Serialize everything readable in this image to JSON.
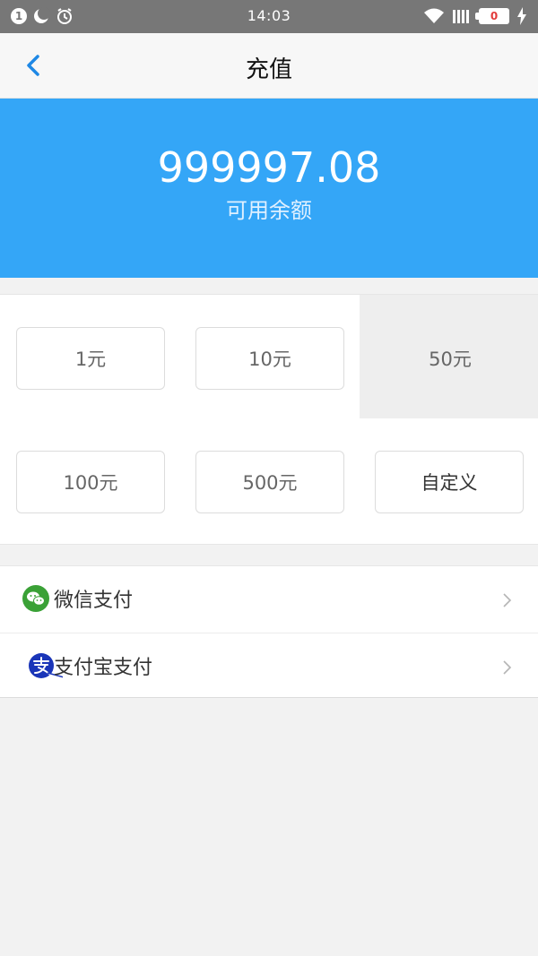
{
  "status_bar": {
    "time": "14:03",
    "notification_badge": "1",
    "battery_level": "0"
  },
  "nav": {
    "title": "充值"
  },
  "balance": {
    "amount": "999997.08",
    "label": "可用余额"
  },
  "amounts": [
    {
      "label": "1元",
      "selected": false
    },
    {
      "label": "10元",
      "selected": false
    },
    {
      "label": "50元",
      "selected": true
    },
    {
      "label": "100元",
      "selected": false
    },
    {
      "label": "500元",
      "selected": false
    },
    {
      "label": "自定义",
      "selected": false
    }
  ],
  "payments": [
    {
      "label": "微信支付",
      "icon": "wechat-pay-icon"
    },
    {
      "label": "支付宝支付",
      "icon": "alipay-icon"
    }
  ],
  "colors": {
    "brand": "#34a6f7",
    "back_arrow": "#1e88e5",
    "wechat_green": "#3aa136",
    "alipay_blue": "#1a35b8"
  }
}
